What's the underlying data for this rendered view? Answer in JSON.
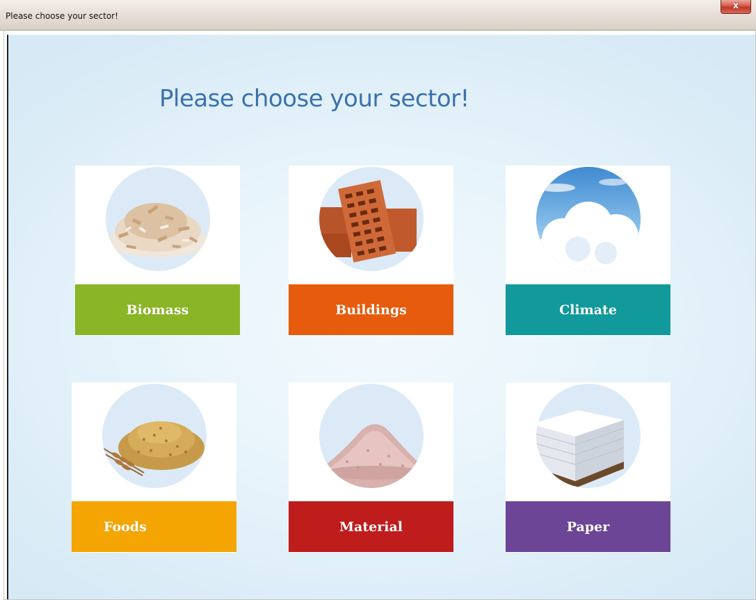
{
  "window": {
    "title": "Please choose your sector!",
    "close_label": "x"
  },
  "main": {
    "heading": "Please choose your sector!"
  },
  "sectors": [
    {
      "label": "Biomass",
      "color": "#8ab526",
      "icon": "wood-chips-icon"
    },
    {
      "label": "Buildings",
      "color": "#e65c0c",
      "icon": "bricks-icon"
    },
    {
      "label": "Climate",
      "color": "#12999b",
      "icon": "cloud-sky-icon"
    },
    {
      "label": "Foods",
      "color": "#f4a501",
      "icon": "grain-wheat-icon"
    },
    {
      "label": "Material",
      "color": "#bf1c1c",
      "icon": "powder-pile-icon"
    },
    {
      "label": "Paper",
      "color": "#6c4596",
      "icon": "paper-stack-icon"
    }
  ]
}
